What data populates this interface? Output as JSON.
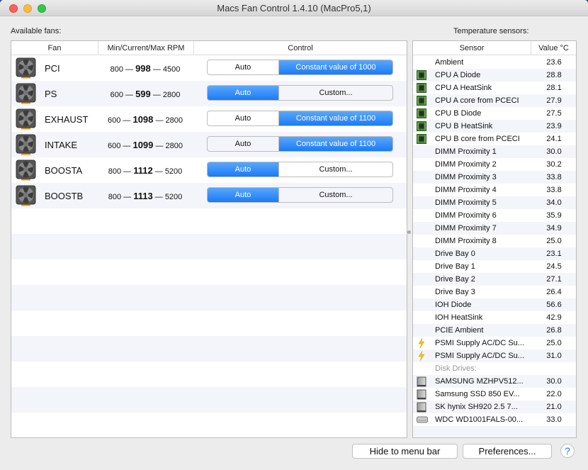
{
  "window": {
    "title": "Macs Fan Control 1.4.10 (MacPro5,1)"
  },
  "fans": {
    "label": "Available fans:",
    "columns": [
      "Fan",
      "Min/Current/Max RPM",
      "Control"
    ],
    "rows": [
      {
        "name": "PCI",
        "min": "800",
        "current": "998",
        "max": "4500",
        "auto": "Auto",
        "custom": "Constant value of 1000",
        "mode": "custom"
      },
      {
        "name": "PS",
        "min": "600",
        "current": "599",
        "max": "2800",
        "auto": "Auto",
        "custom": "Custom...",
        "mode": "auto"
      },
      {
        "name": "EXHAUST",
        "min": "600",
        "current": "1098",
        "max": "2800",
        "auto": "Auto",
        "custom": "Constant value of 1100",
        "mode": "custom"
      },
      {
        "name": "INTAKE",
        "min": "600",
        "current": "1099",
        "max": "2800",
        "auto": "Auto",
        "custom": "Constant value of 1100",
        "mode": "custom"
      },
      {
        "name": "BOOSTA",
        "min": "800",
        "current": "1112",
        "max": "5200",
        "auto": "Auto",
        "custom": "Custom...",
        "mode": "auto"
      },
      {
        "name": "BOOSTB",
        "min": "800",
        "current": "1113",
        "max": "5200",
        "auto": "Auto",
        "custom": "Custom...",
        "mode": "auto"
      }
    ]
  },
  "sensors": {
    "label": "Temperature sensors:",
    "columns": [
      "Sensor",
      "Value °C"
    ],
    "rows": [
      {
        "name": "Ambient",
        "value": "23.6",
        "icon": "none"
      },
      {
        "name": "CPU A Diode",
        "value": "28.8",
        "icon": "chip"
      },
      {
        "name": "CPU A HeatSink",
        "value": "28.1",
        "icon": "chip"
      },
      {
        "name": "CPU A core from PCECI",
        "value": "27.9",
        "icon": "chip"
      },
      {
        "name": "CPU B Diode",
        "value": "27.5",
        "icon": "chip"
      },
      {
        "name": "CPU B HeatSink",
        "value": "23.9",
        "icon": "chip"
      },
      {
        "name": "CPU B core from PCECI",
        "value": "24.1",
        "icon": "chip"
      },
      {
        "name": "DIMM Proximity 1",
        "value": "30.0",
        "icon": "none"
      },
      {
        "name": "DIMM Proximity 2",
        "value": "30.2",
        "icon": "none"
      },
      {
        "name": "DIMM Proximity 3",
        "value": "33.8",
        "icon": "none"
      },
      {
        "name": "DIMM Proximity 4",
        "value": "33.8",
        "icon": "none"
      },
      {
        "name": "DIMM Proximity 5",
        "value": "34.0",
        "icon": "none"
      },
      {
        "name": "DIMM Proximity 6",
        "value": "35.9",
        "icon": "none"
      },
      {
        "name": "DIMM Proximity 7",
        "value": "34.9",
        "icon": "none"
      },
      {
        "name": "DIMM Proximity 8",
        "value": "25.0",
        "icon": "none"
      },
      {
        "name": "Drive Bay 0",
        "value": "23.1",
        "icon": "none"
      },
      {
        "name": "Drive Bay 1",
        "value": "24.5",
        "icon": "none"
      },
      {
        "name": "Drive Bay 2",
        "value": "27.1",
        "icon": "none"
      },
      {
        "name": "Drive Bay 3",
        "value": "26.4",
        "icon": "none"
      },
      {
        "name": "IOH Diode",
        "value": "56.6",
        "icon": "none"
      },
      {
        "name": "IOH HeatSink",
        "value": "42.9",
        "icon": "none"
      },
      {
        "name": "PCIE Ambient",
        "value": "26.8",
        "icon": "none"
      },
      {
        "name": "PSMI Supply AC/DC Su...",
        "value": "25.0",
        "icon": "bolt"
      },
      {
        "name": "PSMI Supply AC/DC Su...",
        "value": "31.0",
        "icon": "bolt"
      }
    ],
    "disk_label": "Disk Drives:",
    "disks": [
      {
        "name": "SAMSUNG MZHPV512...",
        "value": "30.0",
        "icon": "ssd"
      },
      {
        "name": "Samsung SSD 850 EV...",
        "value": "22.0",
        "icon": "ssd"
      },
      {
        "name": "SK hynix SH920 2.5 7...",
        "value": "21.0",
        "icon": "ssd"
      },
      {
        "name": "WDC WD1001FALS-00...",
        "value": "33.0",
        "icon": "hdd"
      }
    ]
  },
  "footer": {
    "hide": "Hide to menu bar",
    "prefs": "Preferences...",
    "help": "?"
  },
  "colors": {
    "accent": "#1b7bf6",
    "stripe": "#f4f5fa"
  }
}
